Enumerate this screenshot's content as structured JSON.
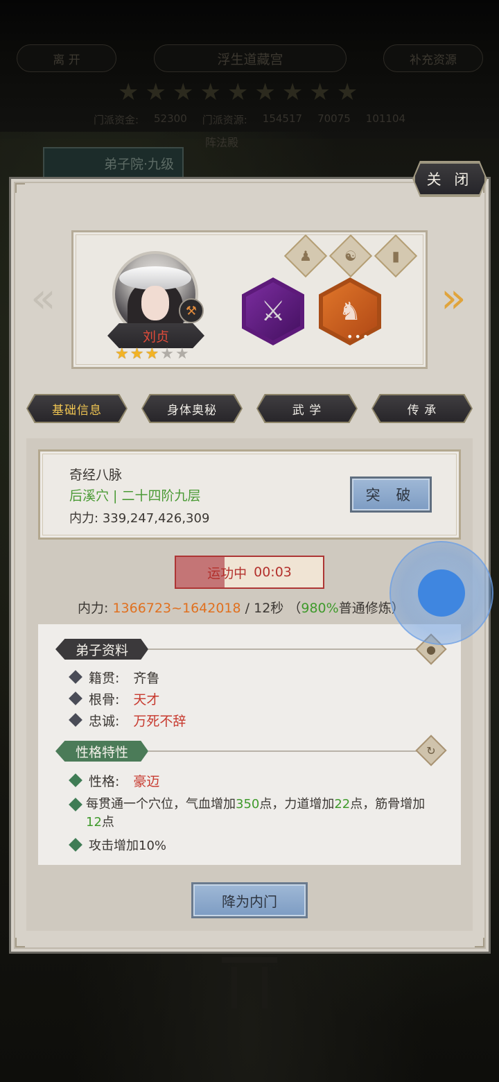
{
  "background": {
    "leave_button": "离 开",
    "title_button": "浮生道藏宫",
    "supply_button": "补充资源",
    "star_count": 9,
    "resources": {
      "funds_label": "门派资金:",
      "funds_value": "52300",
      "materials_label": "门派资源:",
      "materials_value": "154517",
      "res2_value": "70075",
      "res3_value": "101104"
    },
    "building_label": "阵法殿",
    "hall_tag": "弟子院·九级"
  },
  "panel": {
    "close_button": "关 闭"
  },
  "character": {
    "name": "刘贞",
    "stars_filled": 3,
    "stars_total": 5,
    "icons": [
      "figure-icon",
      "yin-yang-icon",
      "scroll-icon"
    ],
    "equipment": [
      {
        "slot": "weapon",
        "rarity_color": "#7b2d9f"
      },
      {
        "slot": "mount",
        "rarity_color": "#e0762a"
      }
    ]
  },
  "tabs": [
    {
      "label": "基础信息",
      "active": true
    },
    {
      "label": "身体奥秘",
      "active": false
    },
    {
      "label": "武 学",
      "active": false
    },
    {
      "label": "传 承",
      "active": false
    }
  ],
  "meridian": {
    "title": "奇经八脉",
    "level": "后溪穴 | 二十四阶九层",
    "power_label": "内力:",
    "power_value": "339,247,426,309",
    "break_button": "突 破"
  },
  "cultivation": {
    "status": "运功中",
    "timer": "00:03",
    "progress": 0.33,
    "power_label": "内力:",
    "power_range": "1366723~1642018",
    "per_time": "/ 12秒",
    "open_paren": "（",
    "rate": "980%",
    "mode": "普通修炼）"
  },
  "profile": {
    "section_title": "弟子资料",
    "rows": [
      {
        "label": "籍贯:",
        "value": "齐鲁",
        "value_color": "#3b3733"
      },
      {
        "label": "根骨:",
        "value": "天才",
        "value_color": "#c7392e"
      },
      {
        "label": "忠诚:",
        "value": "万死不辞",
        "value_color": "#c7392e"
      }
    ]
  },
  "traits": {
    "section_title": "性格特性",
    "personality_label": "性格:",
    "personality_value": "豪迈",
    "effect1": {
      "p1": "每贯通一个穴位，气血增加",
      "n1": "350",
      "p2": "点，力道增加",
      "n2": "22",
      "p3": "点，筋骨增加",
      "n3": "12",
      "p4": "点"
    },
    "effect2": "攻击增加10%"
  },
  "demote_button": "降为内门"
}
